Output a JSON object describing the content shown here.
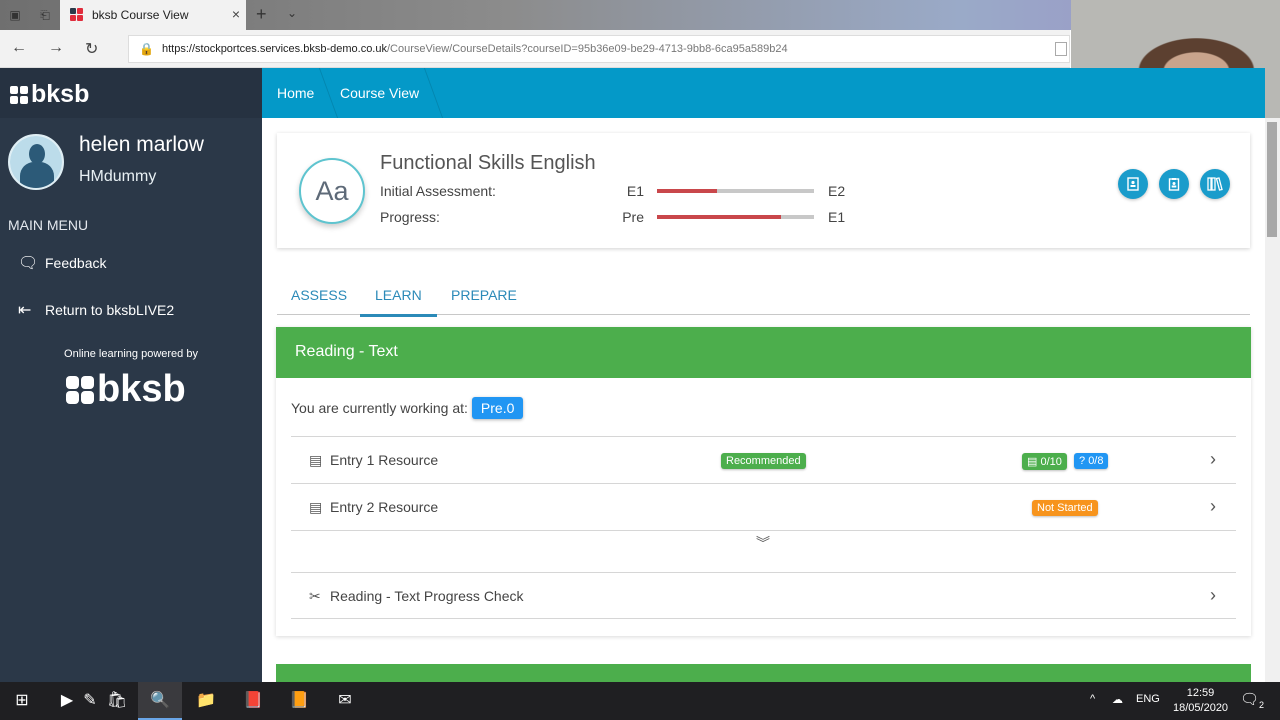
{
  "browser": {
    "tab_title": "bksb Course View",
    "url_host": "https://stockportces.services.bksb-demo.co.uk",
    "url_path": "/CourseView/CourseDetails?courseID=95b36e09-be29-4713-9bb8-6ca95a589b24",
    "icons": {
      "tab_actions": "tab-actions-icon",
      "set_aside": "set-aside-tabs-icon",
      "close": "×",
      "new_tab": "+",
      "tab_menu": "⌄",
      "back": "←",
      "forward": "→",
      "refresh": "↻",
      "lock": "🔒"
    }
  },
  "sidebar": {
    "logo_text": "bksb",
    "user_name": "helen marlow",
    "user_id": "HMdummy",
    "menu_heading": "MAIN MENU",
    "items": [
      {
        "label": "Feedback",
        "icon": "🗨"
      },
      {
        "label": "Return to bksbLIVE2",
        "icon": "⇤"
      }
    ],
    "powered_by": "Online learning powered by",
    "footer_logo_text": "bksb"
  },
  "breadcrumb": [
    {
      "label": "Home"
    },
    {
      "label": "Course View"
    }
  ],
  "course": {
    "badge": "Aa",
    "title": "Functional Skills English",
    "progress_rows": [
      {
        "label": "Initial Assessment:",
        "from": "E1",
        "to": "E2",
        "fraction": 0.38
      },
      {
        "label": "Progress:",
        "from": "Pre",
        "to": "E1",
        "fraction": 0.79
      }
    ],
    "action_buttons": [
      {
        "name": "learner-profile-button",
        "icon": "👤"
      },
      {
        "name": "clipboard-button",
        "icon": "📋"
      },
      {
        "name": "library-button",
        "icon": "📚"
      }
    ],
    "accent_color": "#1a9ccb"
  },
  "tabs": [
    {
      "label": "ASSESS",
      "active": false
    },
    {
      "label": "LEARN",
      "active": true
    },
    {
      "label": "PREPARE",
      "active": false
    }
  ],
  "section": {
    "title": "Reading - Text",
    "header_color": "#4cae4c",
    "working_label": "You are currently working at:",
    "working_level": "Pre.0",
    "rows": [
      {
        "label": "Entry 1 Resource",
        "icon": "▤",
        "status": "Recommended",
        "resources": "0/10",
        "questions": "0/8"
      },
      {
        "label": "Entry 2 Resource",
        "icon": "▤",
        "status": "Not Started"
      },
      {
        "label": "Reading - Text Progress Check",
        "icon": "✂"
      }
    ],
    "expand_icon": "︾",
    "chevron": "›",
    "resource_icon": "▤",
    "question_icon": "?"
  },
  "taskbar": {
    "language": "ENG",
    "time": "12:59",
    "date": "18/05/2020",
    "notifications": "2",
    "tray_up": "^"
  }
}
